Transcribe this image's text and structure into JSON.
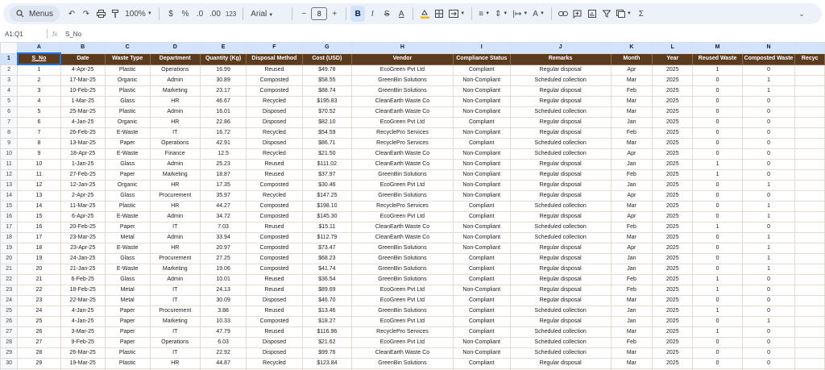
{
  "toolbar": {
    "menus_label": "Menus",
    "zoom": "100%",
    "currency": "$",
    "percent": "%",
    "dec_decrease": ".0",
    "dec_increase": ".00",
    "number_format": "123",
    "font": "Arial",
    "font_size": "8",
    "minus": "−",
    "plus": "+",
    "bold": "B",
    "italic": "I",
    "strike": "S",
    "text_color": "A",
    "sum": "Σ"
  },
  "formula_bar": {
    "cell_ref": "A1:Q1",
    "fx": "fx",
    "content": "S_No"
  },
  "columns": [
    "A",
    "B",
    "C",
    "D",
    "E",
    "F",
    "G",
    "H",
    "I",
    "J",
    "K",
    "L",
    "M",
    "N"
  ],
  "headers": [
    "S_No",
    "Date",
    "Waste Type",
    "Department",
    "Quantity (Kg)",
    "Disposal Method",
    "Cost (USD)",
    "Vendor",
    "Compliance Status",
    "Remarks",
    "Month",
    "Year",
    "Reused Waste",
    "Composted Waste",
    "Recyc"
  ],
  "rows": [
    [
      "1",
      "4-Apr-25",
      "Plastic",
      "Operations",
      "16.99",
      "Reused",
      "$49.78",
      "EcoGreen Pvt Ltd",
      "Compliant",
      "Regular disposal",
      "Apr",
      "2025",
      "1",
      "0"
    ],
    [
      "2",
      "17-Mar-25",
      "Organic",
      "Admin",
      "30.89",
      "Composted",
      "$58.55",
      "GreenBin Solutions",
      "Non-Compliant",
      "Scheduled collection",
      "Mar",
      "2025",
      "0",
      "1"
    ],
    [
      "3",
      "10-Feb-25",
      "Plastic",
      "Marketing",
      "23.17",
      "Composted",
      "$88.74",
      "GreenBin Solutions",
      "Non-Compliant",
      "Regular disposal",
      "Feb",
      "2025",
      "0",
      "1"
    ],
    [
      "4",
      "1-Mar-25",
      "Glass",
      "HR",
      "46.67",
      "Recycled",
      "$195.83",
      "CleanEarth Waste Co",
      "Non-Compliant",
      "Regular disposal",
      "Mar",
      "2025",
      "0",
      "0"
    ],
    [
      "5",
      "25-Mar-25",
      "Plastic",
      "Admin",
      "16.01",
      "Disposed",
      "$70.52",
      "CleanEarth Waste Co",
      "Non-Compliant",
      "Scheduled collection",
      "Mar",
      "2025",
      "0",
      "0"
    ],
    [
      "6",
      "4-Jan-25",
      "Organic",
      "HR",
      "22.86",
      "Disposed",
      "$82.10",
      "EcoGreen Pvt Ltd",
      "Compliant",
      "Regular disposal",
      "Jan",
      "2025",
      "0",
      "0"
    ],
    [
      "7",
      "26-Feb-25",
      "E-Waste",
      "IT",
      "16.72",
      "Recycled",
      "$54.59",
      "RecyclePro Services",
      "Non-Compliant",
      "Regular disposal",
      "Feb",
      "2025",
      "0",
      "0"
    ],
    [
      "8",
      "13-Mar-25",
      "Paper",
      "Operations",
      "42.91",
      "Disposed",
      "$86.71",
      "RecyclePro Services",
      "Compliant",
      "Scheduled collection",
      "Mar",
      "2025",
      "0",
      "0"
    ],
    [
      "9",
      "18-Apr-25",
      "E-Waste",
      "Finance",
      "12.5",
      "Recycled",
      "$21.50",
      "CleanEarth Waste Co",
      "Non-Compliant",
      "Scheduled collection",
      "Apr",
      "2025",
      "0",
      "0"
    ],
    [
      "10",
      "1-Jan-25",
      "Glass",
      "Admin",
      "25.23",
      "Reused",
      "$111.02",
      "CleanEarth Waste Co",
      "Non-Compliant",
      "Regular disposal",
      "Jan",
      "2025",
      "1",
      "0"
    ],
    [
      "11",
      "27-Feb-25",
      "Paper",
      "Marketing",
      "18.87",
      "Reused",
      "$37.97",
      "GreenBin Solutions",
      "Non-Compliant",
      "Regular disposal",
      "Feb",
      "2025",
      "1",
      "0"
    ],
    [
      "12",
      "12-Jan-25",
      "Organic",
      "HR",
      "17.35",
      "Composted",
      "$30.46",
      "EcoGreen Pvt Ltd",
      "Non-Compliant",
      "Regular disposal",
      "Jan",
      "2025",
      "0",
      "1"
    ],
    [
      "13",
      "2-Apr-25",
      "Glass",
      "Procurement",
      "35.97",
      "Recycled",
      "$147.25",
      "GreenBin Solutions",
      "Non-Compliant",
      "Regular disposal",
      "Apr",
      "2025",
      "0",
      "0"
    ],
    [
      "14",
      "11-Mar-25",
      "Plastic",
      "HR",
      "44.27",
      "Composted",
      "$198.10",
      "RecyclePro Services",
      "Compliant",
      "Scheduled collection",
      "Mar",
      "2025",
      "0",
      "1"
    ],
    [
      "15",
      "6-Apr-25",
      "E-Waste",
      "Admin",
      "34.72",
      "Composted",
      "$145.30",
      "EcoGreen Pvt Ltd",
      "Compliant",
      "Regular disposal",
      "Apr",
      "2025",
      "0",
      "1"
    ],
    [
      "16",
      "20-Feb-25",
      "Paper",
      "IT",
      "7.03",
      "Reused",
      "$15.11",
      "CleanEarth Waste Co",
      "Non-Compliant",
      "Scheduled collection",
      "Feb",
      "2025",
      "1",
      "0"
    ],
    [
      "17",
      "23-Mar-25",
      "Metal",
      "Admin",
      "33.94",
      "Composted",
      "$112.79",
      "CleanEarth Waste Co",
      "Non-Compliant",
      "Scheduled collection",
      "Mar",
      "2025",
      "0",
      "1"
    ],
    [
      "18",
      "23-Apr-25",
      "E-Waste",
      "HR",
      "20.97",
      "Composted",
      "$73.47",
      "GreenBin Solutions",
      "Non-Compliant",
      "Regular disposal",
      "Apr",
      "2025",
      "0",
      "1"
    ],
    [
      "19",
      "24-Jan-25",
      "Glass",
      "Procurement",
      "27.25",
      "Composted",
      "$68.23",
      "GreenBin Solutions",
      "Compliant",
      "Regular disposal",
      "Jan",
      "2025",
      "0",
      "1"
    ],
    [
      "20",
      "21-Jan-25",
      "E-Waste",
      "Marketing",
      "19.06",
      "Composted",
      "$41.74",
      "GreenBin Solutions",
      "Compliant",
      "Regular disposal",
      "Jan",
      "2025",
      "0",
      "1"
    ],
    [
      "21",
      "6-Feb-25",
      "Glass",
      "Admin",
      "10.01",
      "Reused",
      "$36.54",
      "GreenBin Solutions",
      "Compliant",
      "Regular disposal",
      "Feb",
      "2025",
      "1",
      "0"
    ],
    [
      "22",
      "18-Feb-25",
      "Metal",
      "IT",
      "24.13",
      "Reused",
      "$89.69",
      "EcoGreen Pvt Ltd",
      "Non-Compliant",
      "Regular disposal",
      "Feb",
      "2025",
      "1",
      "0"
    ],
    [
      "23",
      "22-Mar-25",
      "Metal",
      "IT",
      "30.09",
      "Disposed",
      "$46.70",
      "EcoGreen Pvt Ltd",
      "Compliant",
      "Regular disposal",
      "Mar",
      "2025",
      "0",
      "0"
    ],
    [
      "24",
      "4-Jan-25",
      "Paper",
      "Procurement",
      "3.88",
      "Reused",
      "$13.46",
      "GreenBin Solutions",
      "Compliant",
      "Scheduled collection",
      "Jan",
      "2025",
      "1",
      "0"
    ],
    [
      "25",
      "4-Jan-25",
      "Paper",
      "Marketing",
      "10.33",
      "Composted",
      "$18.27",
      "EcoGreen Pvt Ltd",
      "Compliant",
      "Regular disposal",
      "Jan",
      "2025",
      "0",
      "1"
    ],
    [
      "26",
      "3-Mar-25",
      "Paper",
      "IT",
      "47.79",
      "Reused",
      "$116.96",
      "RecyclePro Services",
      "Compliant",
      "Scheduled collection",
      "Mar",
      "2025",
      "1",
      "0"
    ],
    [
      "27",
      "9-Feb-25",
      "Paper",
      "Operations",
      "6.03",
      "Disposed",
      "$21.62",
      "EcoGreen Pvt Ltd",
      "Non-Compliant",
      "Scheduled collection",
      "Feb",
      "2025",
      "0",
      "0"
    ],
    [
      "28",
      "26-Mar-25",
      "Plastic",
      "IT",
      "22.92",
      "Disposed",
      "$99.76",
      "CleanEarth Waste Co",
      "Non-Compliant",
      "Scheduled collection",
      "Mar",
      "2025",
      "0",
      "0"
    ],
    [
      "29",
      "19-Mar-25",
      "Plastic",
      "HR",
      "44.87",
      "Recycled",
      "$123.84",
      "GreenBin Solutions",
      "Compliant",
      "Regular disposal",
      "Mar",
      "2025",
      "0",
      "0"
    ],
    [
      "30",
      "21-Apr-25",
      "Paper",
      "IT",
      "46.04",
      "Disposed",
      "$156.91",
      "EcoGreen Pvt Ltd",
      "Compliant",
      "Regular disposal",
      "Apr",
      "2025",
      "0",
      "0"
    ]
  ]
}
